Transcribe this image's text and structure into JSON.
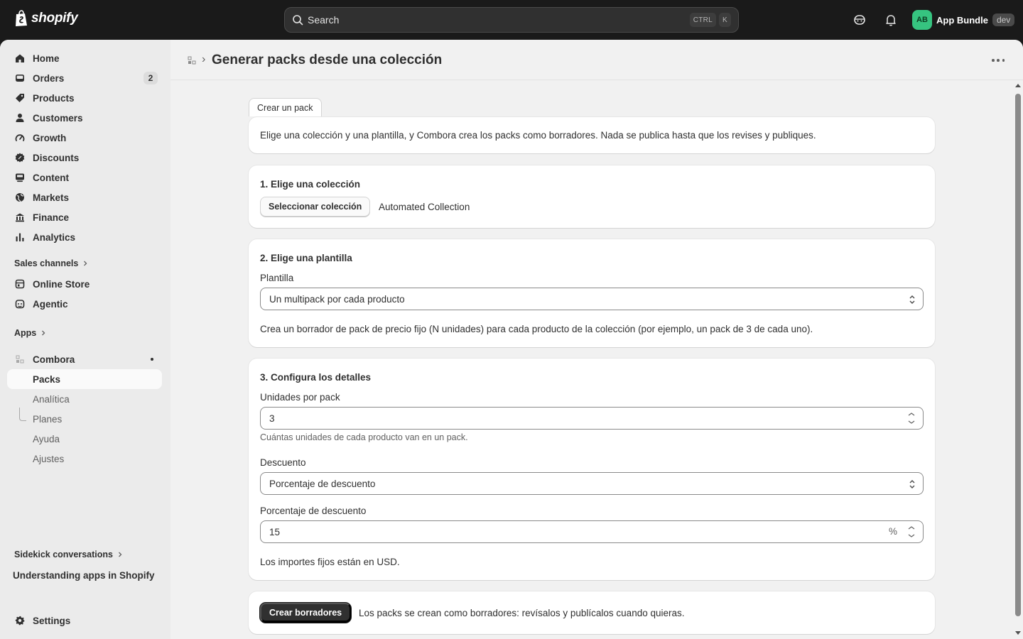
{
  "topbar": {
    "brand": "shopify",
    "search_placeholder": "Search",
    "shortcut_key1": "CTRL",
    "shortcut_key2": "K",
    "avatar_initials": "AB",
    "store_name": "App Bundle",
    "env_badge": "dev"
  },
  "sidebar": {
    "items": [
      {
        "label": "Home",
        "icon": "home-icon"
      },
      {
        "label": "Orders",
        "icon": "inbox-icon",
        "count": "2"
      },
      {
        "label": "Products",
        "icon": "tag-icon"
      },
      {
        "label": "Customers",
        "icon": "person-icon"
      },
      {
        "label": "Growth",
        "icon": "gauge-icon"
      },
      {
        "label": "Discounts",
        "icon": "discount-icon"
      },
      {
        "label": "Content",
        "icon": "content-icon"
      },
      {
        "label": "Markets",
        "icon": "globe-icon"
      },
      {
        "label": "Finance",
        "icon": "bank-icon"
      },
      {
        "label": "Analytics",
        "icon": "bar-chart-icon"
      }
    ],
    "sales_channels_label": "Sales channels",
    "channels": [
      {
        "label": "Online Store",
        "icon": "store-icon"
      },
      {
        "label": "Agentic",
        "icon": "agentic-icon"
      }
    ],
    "apps_label": "Apps",
    "app_name": "Combora",
    "app_subitems": [
      "Packs",
      "Analítica",
      "Planes",
      "Ayuda",
      "Ajustes"
    ],
    "sidekick_label": "Sidekick conversations",
    "sidekick_item": "Understanding apps in Shopify",
    "settings_label": "Settings"
  },
  "page": {
    "title": "Generar packs desde una colección",
    "tab_label": "Crear un pack",
    "intro": "Elige una colección y una plantilla, y Combora crea los packs como borradores. Nada se publica hasta que los revises y publiques.",
    "step1": {
      "heading": "1. Elige una colección",
      "button": "Seleccionar colección",
      "selected": "Automated Collection"
    },
    "step2": {
      "heading": "2. Elige una plantilla",
      "label": "Plantilla",
      "value": "Un multipack por cada producto",
      "help": "Crea un borrador de pack de precio fijo (N unidades) para cada producto de la colección (por ejemplo, un pack de 3 de cada uno)."
    },
    "step3": {
      "heading": "3. Configura los detalles",
      "units_label": "Unidades por pack",
      "units_value": "3",
      "units_help": "Cuántas unidades de cada producto van en un pack.",
      "discount_label": "Descuento",
      "discount_value": "Porcentaje de descuento",
      "percent_label": "Porcentaje de descuento",
      "percent_value": "15",
      "percent_suffix": "%",
      "currency_note": "Los importes fijos están en USD."
    },
    "footer": {
      "button": "Crear borradores",
      "note": "Los packs se crean como borradores: revísalos y publícalos cuando quieras."
    }
  },
  "colors": {
    "topbar_bg": "#1a1a1a",
    "avatar_bg": "#36c480",
    "primary_button": "#303030"
  }
}
